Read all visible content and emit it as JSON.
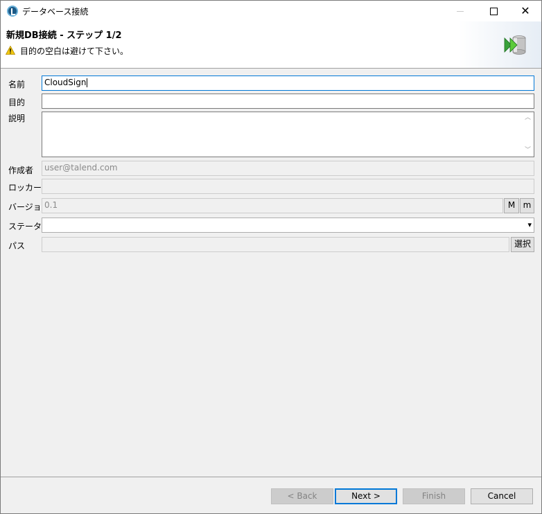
{
  "window": {
    "title": "データベース接続",
    "icon": "talend-icon",
    "controls": {
      "minimize": "minimize-icon",
      "maximize": "maximize-icon",
      "close": "close-icon"
    }
  },
  "banner": {
    "title": "新規DB接続 - ステップ 1/2",
    "message": "目的の空白は避けて下さい。",
    "message_icon": "warning-icon",
    "image_icon": "database-wizard-icon"
  },
  "form": {
    "name": {
      "label": "名前",
      "value": "CloudSign"
    },
    "purpose": {
      "label": "目的",
      "value": ""
    },
    "description": {
      "label": "説明",
      "value": ""
    },
    "author": {
      "label": "作成者",
      "value": "user@talend.com"
    },
    "locker": {
      "label": "ロッカー",
      "value": ""
    },
    "version": {
      "label": "バージョン",
      "value": "0.1",
      "major_btn": "M",
      "minor_btn": "m"
    },
    "status": {
      "label": "ステータス",
      "value": ""
    },
    "path": {
      "label": "パス",
      "value": "",
      "select_btn": "選択"
    }
  },
  "buttons": {
    "back": "< Back",
    "next": "Next >",
    "finish": "Finish",
    "cancel": "Cancel"
  },
  "colors": {
    "focus_border": "#0078d7",
    "warning": "#f2c811",
    "disabled_bg": "#f0f0f0"
  }
}
